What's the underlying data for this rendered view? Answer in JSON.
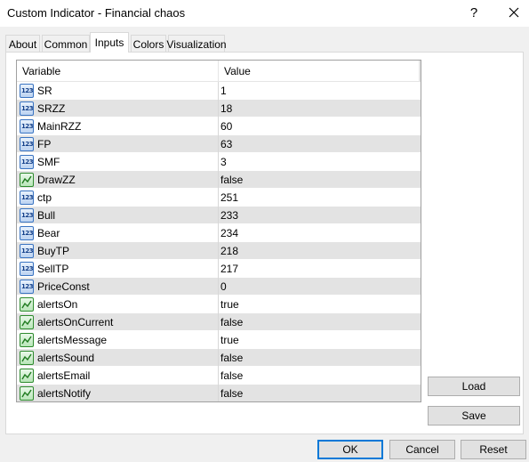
{
  "window": {
    "title": "Custom Indicator - Financial chaos",
    "help_glyph": "?",
    "close_glyph": "✕"
  },
  "tabs": [
    {
      "label": "About",
      "active": false
    },
    {
      "label": "Common",
      "active": false
    },
    {
      "label": "Inputs",
      "active": true
    },
    {
      "label": "Colors",
      "active": false
    },
    {
      "label": "Visualization",
      "active": false
    }
  ],
  "grid": {
    "columns": {
      "variable": "Variable",
      "value": "Value"
    },
    "icon_glyph_number": "123",
    "rows": [
      {
        "name": "SR",
        "value": "1",
        "type": "number"
      },
      {
        "name": "SRZZ",
        "value": "18",
        "type": "number"
      },
      {
        "name": "MainRZZ",
        "value": "60",
        "type": "number"
      },
      {
        "name": "FP",
        "value": "63",
        "type": "number"
      },
      {
        "name": "SMF",
        "value": "3",
        "type": "number"
      },
      {
        "name": "DrawZZ",
        "value": "false",
        "type": "bool"
      },
      {
        "name": "ctp",
        "value": "251",
        "type": "number"
      },
      {
        "name": "Bull",
        "value": "233",
        "type": "number"
      },
      {
        "name": "Bear",
        "value": "234",
        "type": "number"
      },
      {
        "name": "BuyTP",
        "value": "218",
        "type": "number"
      },
      {
        "name": "SellTP",
        "value": "217",
        "type": "number"
      },
      {
        "name": "PriceConst",
        "value": "0",
        "type": "number"
      },
      {
        "name": "alertsOn",
        "value": "true",
        "type": "bool"
      },
      {
        "name": "alertsOnCurrent",
        "value": "false",
        "type": "bool"
      },
      {
        "name": "alertsMessage",
        "value": "true",
        "type": "bool"
      },
      {
        "name": "alertsSound",
        "value": "false",
        "type": "bool"
      },
      {
        "name": "alertsEmail",
        "value": "false",
        "type": "bool"
      },
      {
        "name": "alertsNotify",
        "value": "false",
        "type": "bool"
      }
    ]
  },
  "side_buttons": {
    "load": "Load",
    "save": "Save"
  },
  "footer_buttons": {
    "ok": "OK",
    "cancel": "Cancel",
    "reset": "Reset"
  },
  "colors": {
    "accent": "#0078d7",
    "row_alt": "#e3e3e3",
    "bool_icon": "#2e8b2e",
    "number_icon": "#3a74c2"
  }
}
